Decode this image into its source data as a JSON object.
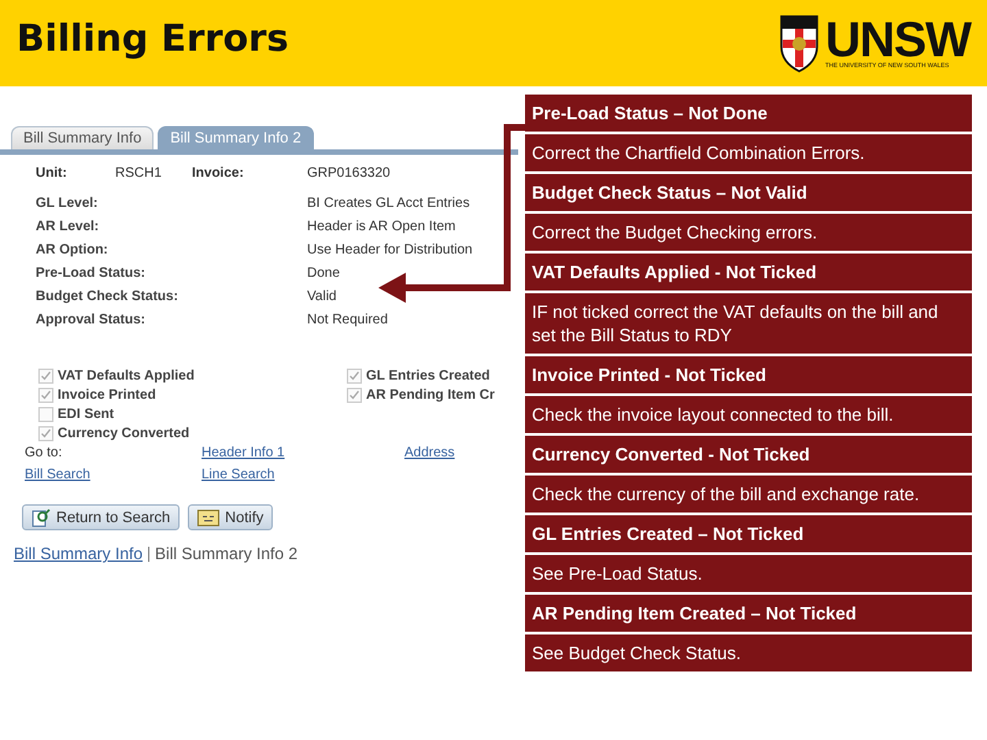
{
  "slide": {
    "title": "Billing Errors",
    "logo": {
      "name": "UNSW",
      "subtitle": "THE UNIVERSITY OF NEW SOUTH WALES"
    }
  },
  "screenshot": {
    "tabs": [
      {
        "label": "Bill Summary Info",
        "selected": false
      },
      {
        "label": "Bill Summary Info 2",
        "selected": true
      }
    ],
    "header_fields": [
      {
        "label": "Unit:",
        "value": "RSCH1"
      },
      {
        "label": "Invoice:",
        "value": "GRP0163320"
      }
    ],
    "fields": [
      {
        "label": "GL Level:",
        "value": "BI Creates GL Acct Entries"
      },
      {
        "label": "AR Level:",
        "value": "Header is AR Open Item"
      },
      {
        "label": "AR Option:",
        "value": "Use Header for Distribution"
      },
      {
        "label": "Pre-Load Status:",
        "value": "Done"
      },
      {
        "label": "Budget Check Status:",
        "value": "Valid"
      },
      {
        "label": "Approval Status:",
        "value": "Not Required"
      }
    ],
    "checkboxes_left": [
      {
        "label": "VAT Defaults Applied",
        "checked": true
      },
      {
        "label": "Invoice Printed",
        "checked": true
      },
      {
        "label": "EDI Sent",
        "checked": false
      },
      {
        "label": "Currency Converted",
        "checked": true
      }
    ],
    "checkboxes_right": [
      {
        "label": "GL Entries Created",
        "checked": true
      },
      {
        "label": "AR Pending Item Cr",
        "checked": true
      }
    ],
    "goto_label": "Go to:",
    "links": [
      "Header Info 1",
      "Address",
      "Bill Search",
      "Line Search"
    ],
    "buttons": [
      {
        "label": "Return to Search",
        "kind": "search"
      },
      {
        "label": "Notify",
        "kind": "notify"
      }
    ],
    "footer_links": [
      {
        "label": "Bill Summary Info",
        "selected": false
      },
      {
        "label": "Bill Summary Info 2",
        "selected": true
      }
    ]
  },
  "callouts": [
    {
      "title": "Pre-Load Status – Not Done",
      "text": "Correct the Chartfield Combination Errors."
    },
    {
      "title": "Budget Check Status – Not Valid",
      "text": "Correct the Budget Checking errors."
    },
    {
      "title": "VAT Defaults Applied - Not Ticked",
      "text": "IF not ticked correct the VAT defaults on the bill and set the Bill Status to RDY"
    },
    {
      "title": "Invoice Printed - Not Ticked",
      "text": "Check the invoice layout connected to the bill."
    },
    {
      "title": "Currency Converted - Not Ticked",
      "text": "Check the currency of the bill and exchange rate."
    },
    {
      "title": "GL Entries Created – Not Ticked",
      "text": "See Pre-Load Status."
    },
    {
      "title": "AR Pending Item Created – Not Ticked",
      "text": "See Budget Check Status."
    }
  ]
}
